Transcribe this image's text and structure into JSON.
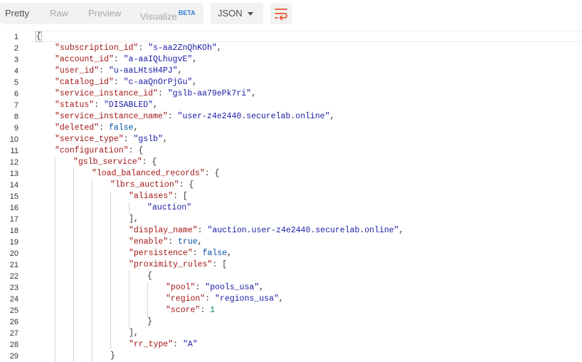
{
  "toolbar": {
    "tabs": [
      {
        "label": "Pretty",
        "active": true
      },
      {
        "label": "Raw",
        "active": false
      },
      {
        "label": "Preview",
        "active": false
      },
      {
        "label": "Visualize",
        "badge": "BETA",
        "active": false
      }
    ],
    "format_selected": "JSON",
    "wrap_icon": "wrap-lines-icon"
  },
  "colors": {
    "accent": "#e8542c",
    "key": "#a31515",
    "string": "#1a1aa6",
    "number": "#098658"
  },
  "editor": {
    "lines": [
      {
        "n": "1",
        "indent": 0,
        "parts": [
          [
            "p",
            "{"
          ]
        ]
      },
      {
        "n": "2",
        "indent": 1,
        "parts": [
          [
            "k",
            "\"subscription_id\""
          ],
          [
            "p",
            ": "
          ],
          [
            "s",
            "\"s-aa2ZnQhKOh\""
          ],
          [
            "p",
            ","
          ]
        ]
      },
      {
        "n": "3",
        "indent": 1,
        "parts": [
          [
            "k",
            "\"account_id\""
          ],
          [
            "p",
            ": "
          ],
          [
            "s",
            "\"a-aaIQLhugvE\""
          ],
          [
            "p",
            ","
          ]
        ]
      },
      {
        "n": "4",
        "indent": 1,
        "parts": [
          [
            "k",
            "\"user_id\""
          ],
          [
            "p",
            ": "
          ],
          [
            "s",
            "\"u-aaLHtsH4PJ\""
          ],
          [
            "p",
            ","
          ]
        ]
      },
      {
        "n": "5",
        "indent": 1,
        "parts": [
          [
            "k",
            "\"catalog_id\""
          ],
          [
            "p",
            ": "
          ],
          [
            "s",
            "\"c-aaQnOrPjGu\""
          ],
          [
            "p",
            ","
          ]
        ]
      },
      {
        "n": "6",
        "indent": 1,
        "parts": [
          [
            "k",
            "\"service_instance_id\""
          ],
          [
            "p",
            ": "
          ],
          [
            "s",
            "\"gslb-aa79ePk7ri\""
          ],
          [
            "p",
            ","
          ]
        ]
      },
      {
        "n": "7",
        "indent": 1,
        "parts": [
          [
            "k",
            "\"status\""
          ],
          [
            "p",
            ": "
          ],
          [
            "s",
            "\"DISABLED\""
          ],
          [
            "p",
            ","
          ]
        ]
      },
      {
        "n": "8",
        "indent": 1,
        "parts": [
          [
            "k",
            "\"service_instance_name\""
          ],
          [
            "p",
            ": "
          ],
          [
            "s",
            "\"user-z4e2440.securelab.online\""
          ],
          [
            "p",
            ","
          ]
        ]
      },
      {
        "n": "9",
        "indent": 1,
        "parts": [
          [
            "k",
            "\"deleted\""
          ],
          [
            "p",
            ": "
          ],
          [
            "b",
            "false"
          ],
          [
            "p",
            ","
          ]
        ]
      },
      {
        "n": "10",
        "indent": 1,
        "parts": [
          [
            "k",
            "\"service_type\""
          ],
          [
            "p",
            ": "
          ],
          [
            "s",
            "\"gslb\""
          ],
          [
            "p",
            ","
          ]
        ]
      },
      {
        "n": "11",
        "indent": 1,
        "parts": [
          [
            "k",
            "\"configuration\""
          ],
          [
            "p",
            ": {"
          ]
        ]
      },
      {
        "n": "12",
        "indent": 2,
        "parts": [
          [
            "k",
            "\"gslb_service\""
          ],
          [
            "p",
            ": {"
          ]
        ]
      },
      {
        "n": "13",
        "indent": 3,
        "parts": [
          [
            "k",
            "\"load_balanced_records\""
          ],
          [
            "p",
            ": {"
          ]
        ]
      },
      {
        "n": "14",
        "indent": 4,
        "parts": [
          [
            "k",
            "\"lbrs_auction\""
          ],
          [
            "p",
            ": {"
          ]
        ]
      },
      {
        "n": "15",
        "indent": 5,
        "parts": [
          [
            "k",
            "\"aliases\""
          ],
          [
            "p",
            ": ["
          ]
        ]
      },
      {
        "n": "16",
        "indent": 6,
        "parts": [
          [
            "s",
            "\"auction\""
          ]
        ]
      },
      {
        "n": "17",
        "indent": 5,
        "parts": [
          [
            "p",
            "],"
          ]
        ]
      },
      {
        "n": "18",
        "indent": 5,
        "parts": [
          [
            "k",
            "\"display_name\""
          ],
          [
            "p",
            ": "
          ],
          [
            "s",
            "\"auction.user-z4e2440.securelab.online\""
          ],
          [
            "p",
            ","
          ]
        ]
      },
      {
        "n": "19",
        "indent": 5,
        "parts": [
          [
            "k",
            "\"enable\""
          ],
          [
            "p",
            ": "
          ],
          [
            "b",
            "true"
          ],
          [
            "p",
            ","
          ]
        ]
      },
      {
        "n": "20",
        "indent": 5,
        "parts": [
          [
            "k",
            "\"persistence\""
          ],
          [
            "p",
            ": "
          ],
          [
            "b",
            "false"
          ],
          [
            "p",
            ","
          ]
        ]
      },
      {
        "n": "21",
        "indent": 5,
        "parts": [
          [
            "k",
            "\"proximity_rules\""
          ],
          [
            "p",
            ": ["
          ]
        ]
      },
      {
        "n": "22",
        "indent": 6,
        "parts": [
          [
            "p",
            "{"
          ]
        ]
      },
      {
        "n": "23",
        "indent": 7,
        "parts": [
          [
            "k",
            "\"pool\""
          ],
          [
            "p",
            ": "
          ],
          [
            "s",
            "\"pools_usa\""
          ],
          [
            "p",
            ","
          ]
        ]
      },
      {
        "n": "24",
        "indent": 7,
        "parts": [
          [
            "k",
            "\"region\""
          ],
          [
            "p",
            ": "
          ],
          [
            "s",
            "\"regions_usa\""
          ],
          [
            "p",
            ","
          ]
        ]
      },
      {
        "n": "25",
        "indent": 7,
        "parts": [
          [
            "k",
            "\"score\""
          ],
          [
            "p",
            ": "
          ],
          [
            "n",
            "1"
          ]
        ]
      },
      {
        "n": "26",
        "indent": 6,
        "parts": [
          [
            "p",
            "}"
          ]
        ]
      },
      {
        "n": "27",
        "indent": 5,
        "parts": [
          [
            "p",
            "],"
          ]
        ]
      },
      {
        "n": "28",
        "indent": 5,
        "parts": [
          [
            "k",
            "\"rr_type\""
          ],
          [
            "p",
            ": "
          ],
          [
            "s",
            "\"A\""
          ]
        ]
      },
      {
        "n": "29",
        "indent": 4,
        "parts": [
          [
            "p",
            "}"
          ]
        ]
      }
    ]
  }
}
